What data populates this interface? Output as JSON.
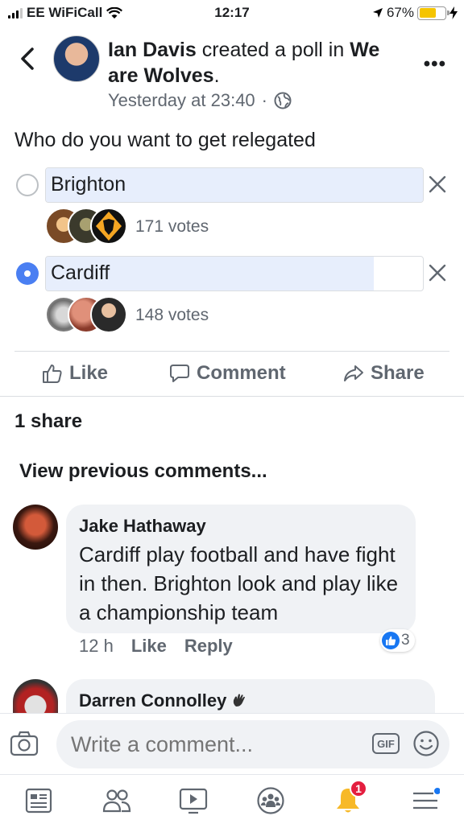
{
  "status_bar": {
    "carrier": "EE WiFiCall",
    "time": "12:17",
    "battery": "67%",
    "battery_level": 0.67
  },
  "post": {
    "author": "Ian Davis",
    "action_text": " created a poll in ",
    "group": "We are Wolves",
    "group_suffix": ".",
    "timestamp": "Yesterday at 23:40",
    "separator": "·",
    "privacy_icon": "globe-icon"
  },
  "poll": {
    "question": "Who do you want to get relegated",
    "options": [
      {
        "label": "Brighton",
        "votes": "171 votes",
        "selected": false,
        "share": 1.0
      },
      {
        "label": "Cardiff",
        "votes": "148 votes",
        "selected": true,
        "share": 0.87
      }
    ]
  },
  "actions": {
    "like": "Like",
    "comment": "Comment",
    "share": "Share"
  },
  "shares_text": "1 share",
  "view_previous": "View previous comments...",
  "comments": [
    {
      "name": "Jake Hathaway",
      "text": "Cardiff play football and have fight in then. Brighton look and play like a championship team",
      "time": "12 h",
      "like": "Like",
      "reply": "Reply",
      "reaction_count": "3"
    },
    {
      "name": "Darren Connolley"
    }
  ],
  "composer": {
    "placeholder": "Write a comment...",
    "gif": "GIF"
  },
  "tabbar": {
    "notifications_badge": "1"
  },
  "colors": {
    "accent": "#4a7ff2",
    "poll_fill": "#e7eefc",
    "badge": "#e41e3f"
  }
}
